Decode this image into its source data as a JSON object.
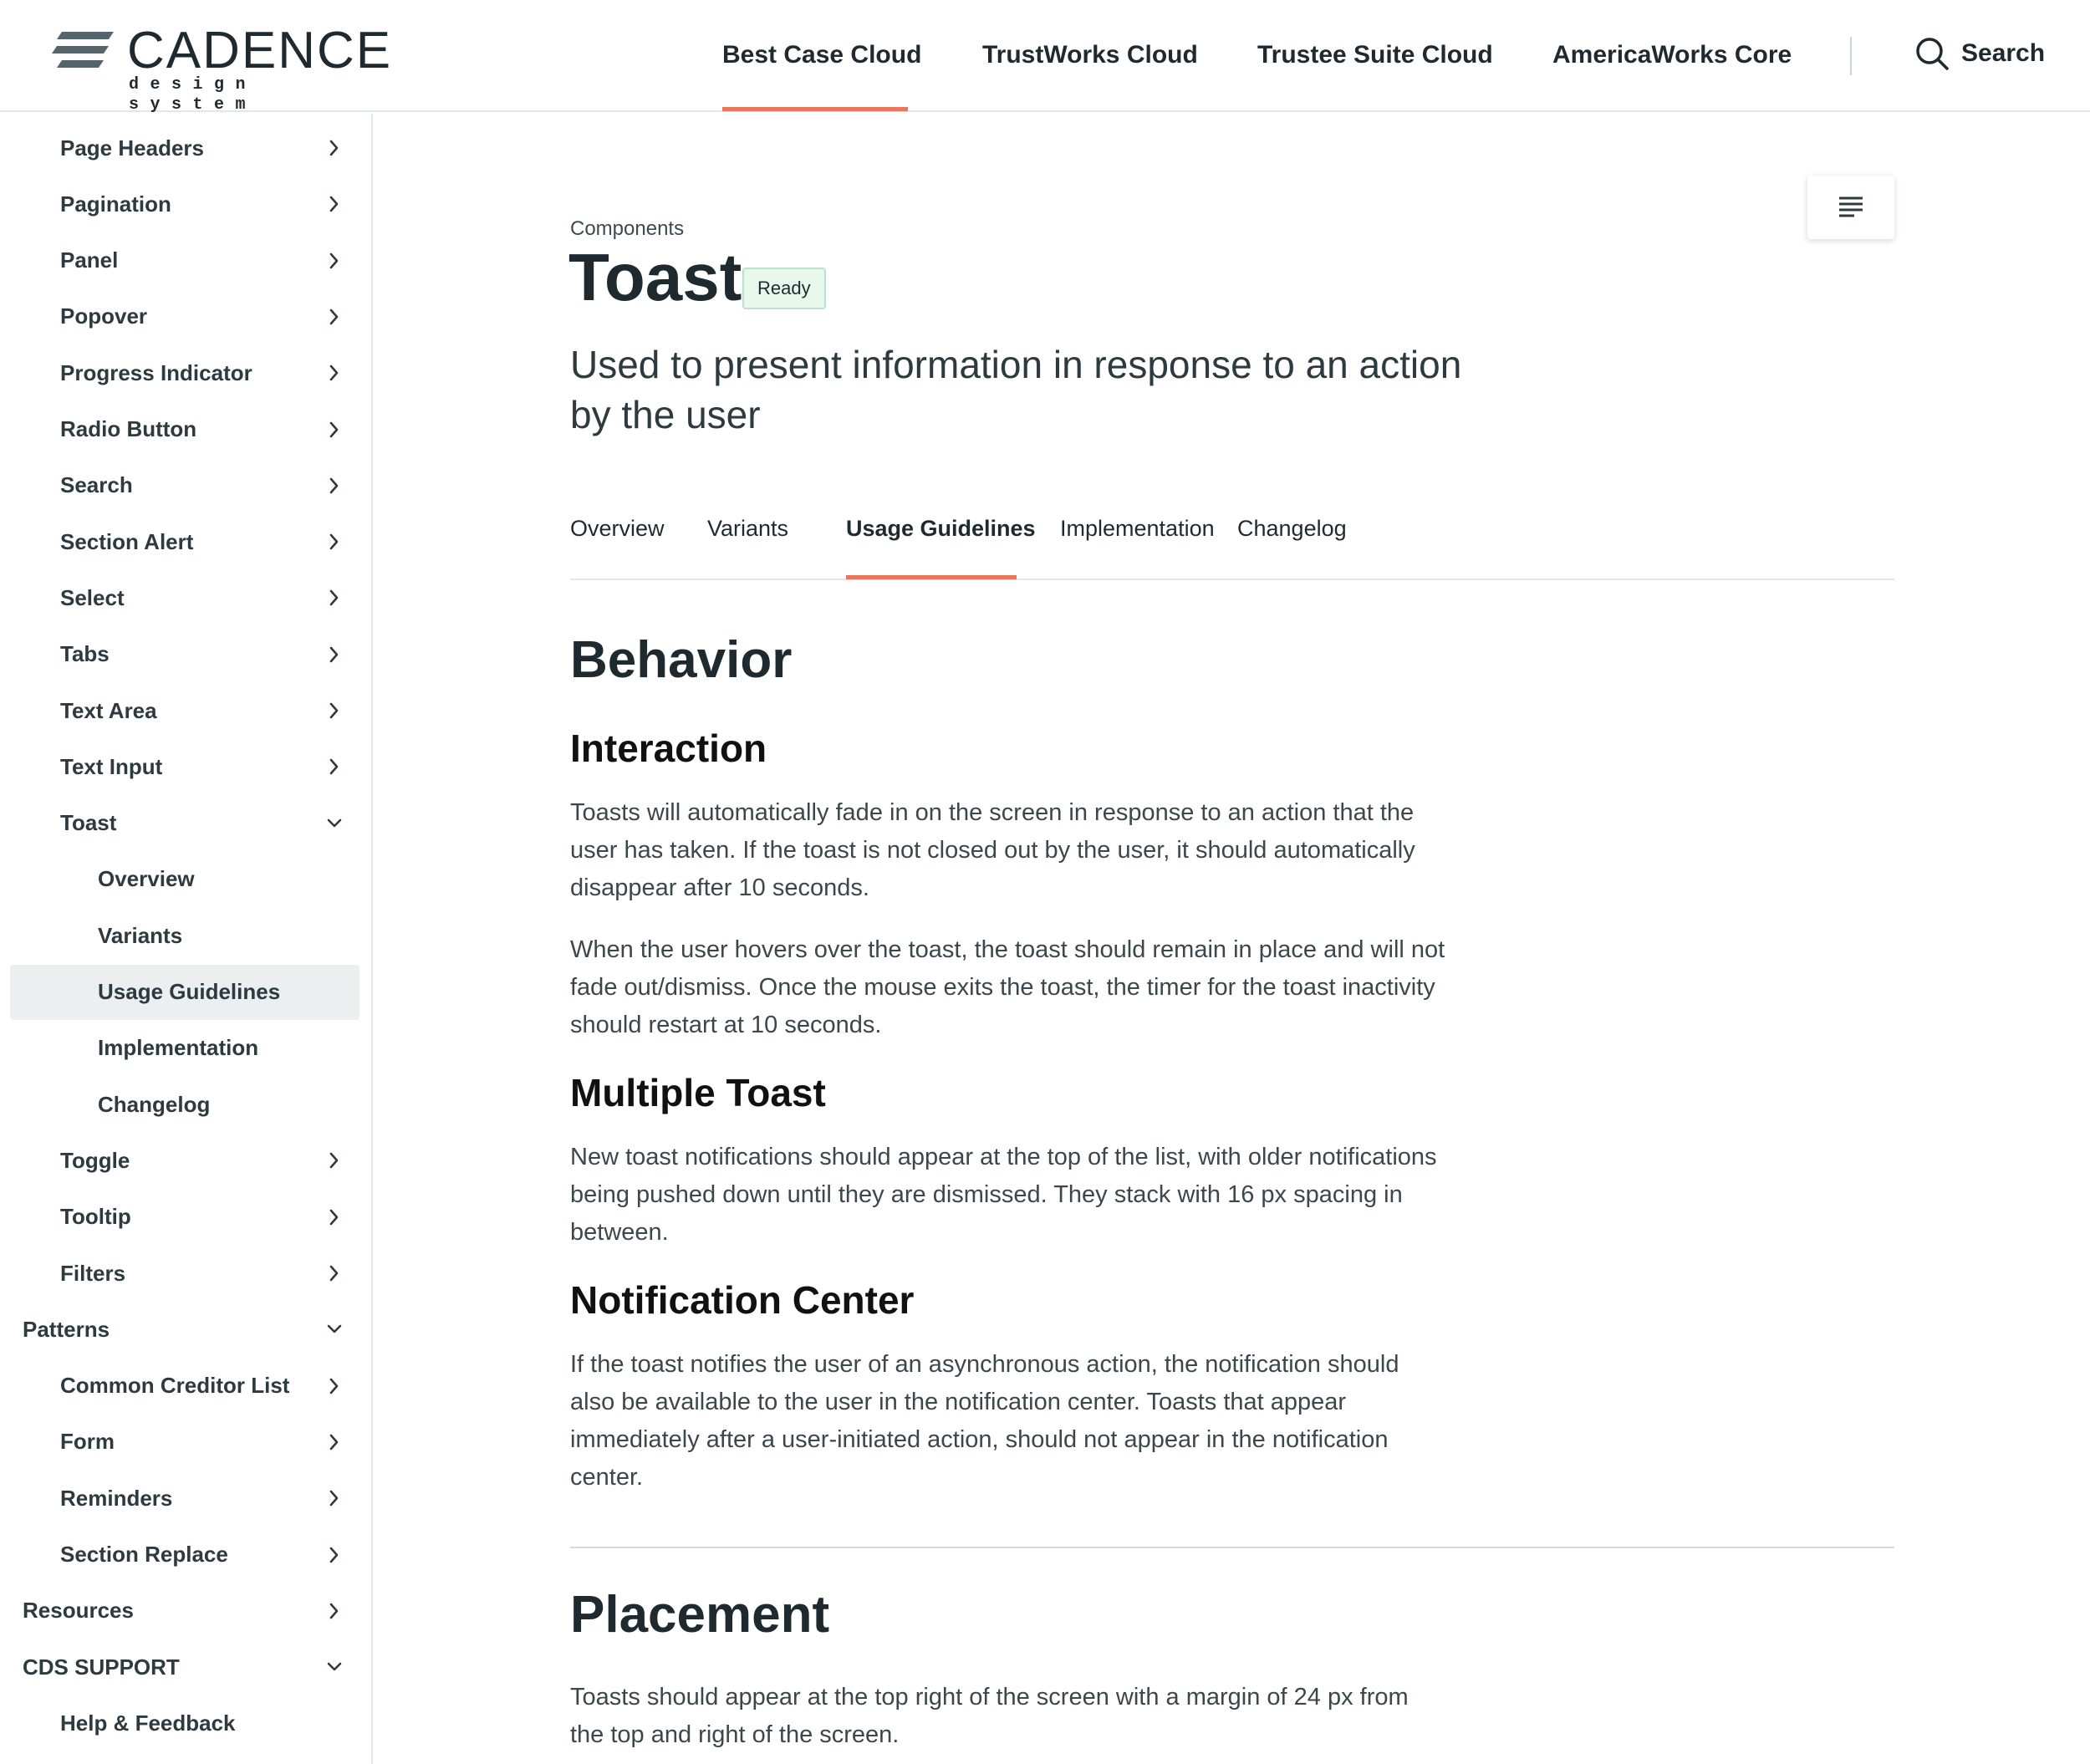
{
  "logo": {
    "name": "CADENCE",
    "tagline": "design system"
  },
  "top_nav": {
    "items": [
      {
        "label": "Best Case Cloud",
        "active": true
      },
      {
        "label": "TrustWorks Cloud"
      },
      {
        "label": "Trustee Suite Cloud"
      },
      {
        "label": "AmericaWorks Core"
      }
    ],
    "search_label": "Search",
    "accent_color": "#e8765f"
  },
  "sidebar": {
    "items": [
      {
        "label": "Page Headers",
        "level": 1,
        "chevron": "right"
      },
      {
        "label": "Pagination",
        "level": 1,
        "chevron": "right"
      },
      {
        "label": "Panel",
        "level": 1,
        "chevron": "right"
      },
      {
        "label": "Popover",
        "level": 1,
        "chevron": "right"
      },
      {
        "label": "Progress Indicator",
        "level": 1,
        "chevron": "right"
      },
      {
        "label": "Radio Button",
        "level": 1,
        "chevron": "right"
      },
      {
        "label": "Search",
        "level": 1,
        "chevron": "right"
      },
      {
        "label": "Section Alert",
        "level": 1,
        "chevron": "right"
      },
      {
        "label": "Select",
        "level": 1,
        "chevron": "right"
      },
      {
        "label": "Tabs",
        "level": 1,
        "chevron": "right"
      },
      {
        "label": "Text Area",
        "level": 1,
        "chevron": "right"
      },
      {
        "label": "Text Input",
        "level": 1,
        "chevron": "right"
      },
      {
        "label": "Toast",
        "level": 1,
        "chevron": "down"
      },
      {
        "label": "Overview",
        "level": 2
      },
      {
        "label": "Variants",
        "level": 2
      },
      {
        "label": "Usage Guidelines",
        "level": 2,
        "selected": true
      },
      {
        "label": "Implementation",
        "level": 2
      },
      {
        "label": "Changelog",
        "level": 2
      },
      {
        "label": "Toggle",
        "level": 1,
        "chevron": "right"
      },
      {
        "label": "Tooltip",
        "level": 1,
        "chevron": "right"
      },
      {
        "label": "Filters",
        "level": 1,
        "chevron": "right"
      },
      {
        "label": "Patterns",
        "level": 0,
        "chevron": "down"
      },
      {
        "label": "Common Creditor List",
        "level": 1,
        "chevron": "right"
      },
      {
        "label": "Form",
        "level": 1,
        "chevron": "right"
      },
      {
        "label": "Reminders",
        "level": 1,
        "chevron": "right"
      },
      {
        "label": "Section Replace",
        "level": 1,
        "chevron": "right"
      },
      {
        "label": "Resources",
        "level": 0,
        "chevron": "right"
      },
      {
        "label": "CDS SUPPORT",
        "level": 0,
        "chevron": "down"
      },
      {
        "label": "Help & Feedback",
        "level": 1
      }
    ]
  },
  "page": {
    "breadcrumb": "Components",
    "title": "Toast",
    "status_badge": "Ready",
    "subtitle": "Used to present information in response to an action by the user",
    "tabs": [
      {
        "label": "Overview"
      },
      {
        "label": "Variants"
      },
      {
        "label": "Usage Guidelines",
        "active": true
      },
      {
        "label": "Implementation"
      },
      {
        "label": "Changelog"
      }
    ]
  },
  "content": {
    "behavior": {
      "heading": "Behavior",
      "interaction": {
        "heading": "Interaction",
        "p1": "Toasts will automatically fade in on the screen in response to an action that the user has taken. If the toast is not closed out by the user, it should automatically disappear after 10 seconds.",
        "p2": "When the user hovers over the toast, the toast should remain in place and will not fade out/dismiss. Once the mouse exits the toast, the timer for the toast inactivity should restart at 10 seconds."
      },
      "multiple_toast": {
        "heading": "Multiple Toast",
        "p1": "New toast notifications should appear at the top of the list, with older notifications being pushed down until they are dismissed. They stack with 16 px spacing in between."
      },
      "notification_center": {
        "heading": "Notification Center",
        "p1": "If the toast notifies the user of an asynchronous action, the notification should also be available to the user in the notification center. Toasts that appear immediately after a user-initiated action, should not appear in the notification center."
      }
    },
    "placement": {
      "heading": "Placement",
      "p1": "Toasts should appear at the top right of the screen with a margin of 24 px from the top and right of the screen."
    }
  }
}
